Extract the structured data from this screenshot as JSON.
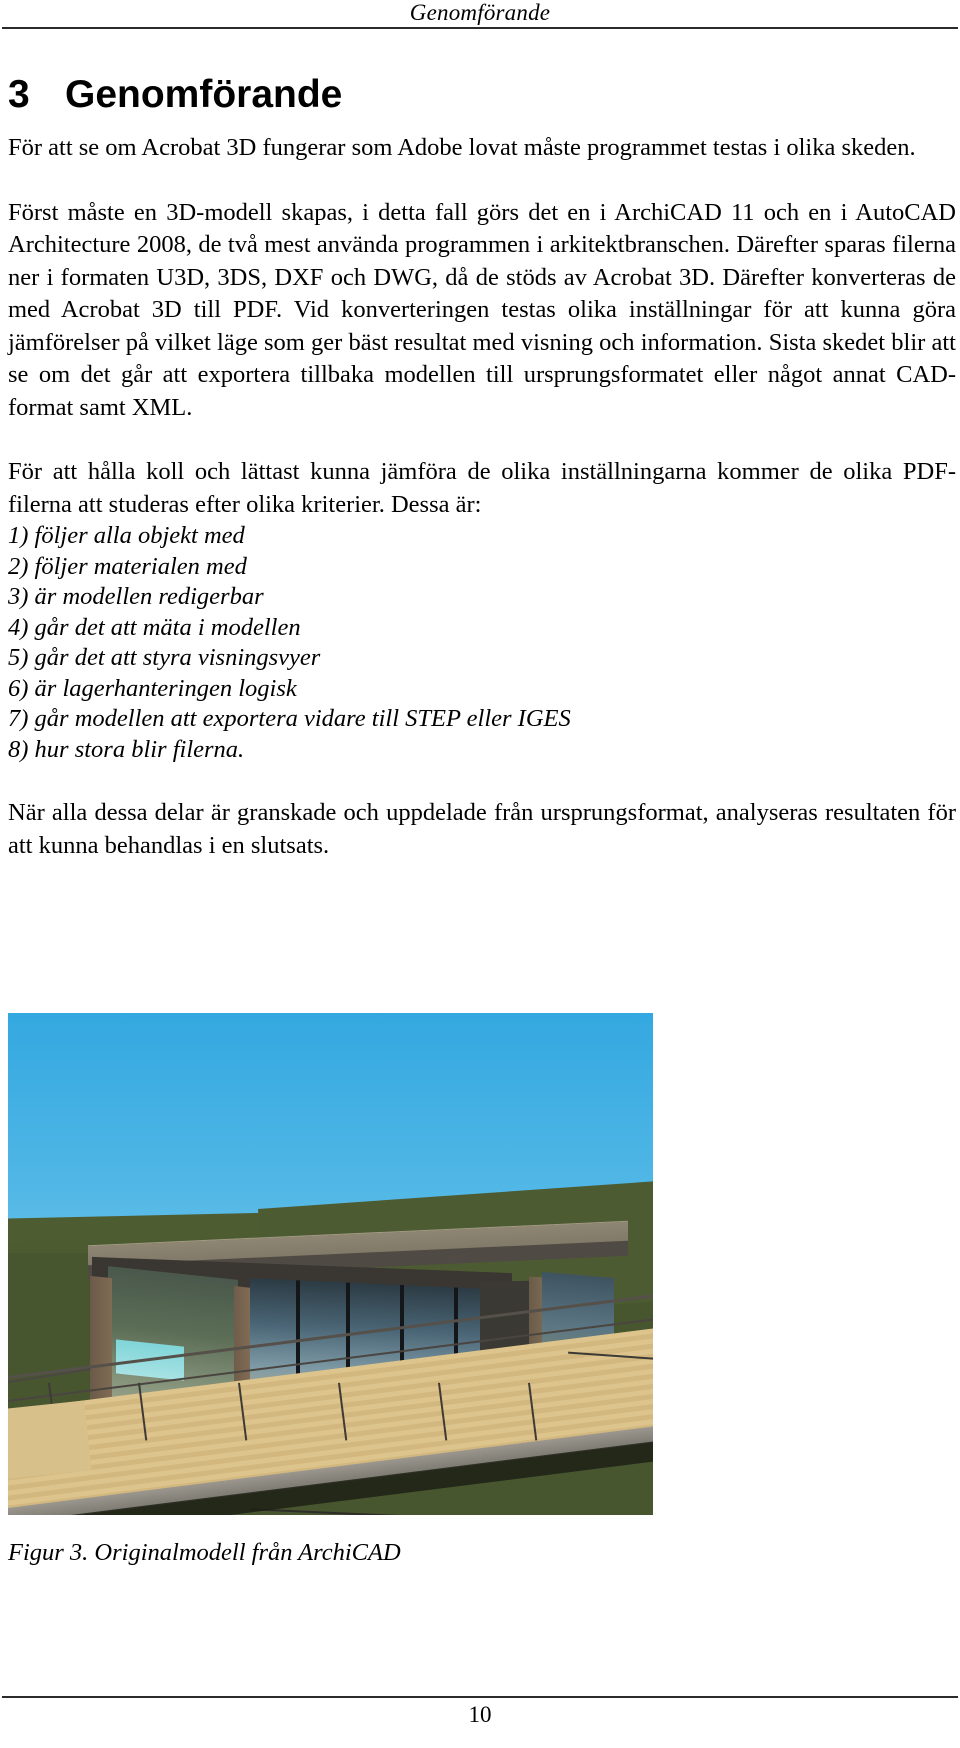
{
  "header": {
    "running_title": "Genomförande"
  },
  "heading": {
    "number": "3",
    "title": "Genomförande"
  },
  "body": {
    "paragraph_1": "För att se om Acrobat 3D fungerar som Adobe lovat måste programmet testas i olika skeden.",
    "paragraph_2": "Först måste en 3D-modell skapas, i detta fall görs det en i ArchiCAD 11 och en i AutoCAD Architecture 2008, de två mest använda programmen i arkitektbranschen. Därefter sparas filerna ner i formaten U3D, 3DS, DXF och DWG, då de stöds av Acrobat 3D. Därefter konverteras de med Acrobat 3D till PDF. Vid konverteringen testas olika inställningar för att kunna göra jämförelser på vilket läge som ger bäst resultat med visning och information. Sista skedet blir att se om det går att exportera tillbaka modellen till ursprungsformatet eller något annat CAD-format samt XML.",
    "paragraph_3": "För att hålla koll och lättast kunna jämföra de olika inställningarna kommer de olika PDF-filerna att studeras efter olika kriterier. Dessa är:",
    "criteria": [
      "1) följer alla objekt med",
      "2) följer materialen med",
      "3) är modellen redigerbar",
      "4) går det att mäta i modellen",
      "5) går det att styra visningsvyer",
      "6) är lagerhanteringen logisk",
      "7) går modellen att exportera vidare till STEP eller IGES",
      "8) hur stora blir filerna."
    ],
    "paragraph_4": "När alla dessa delar är granskade och uppdelade från ursprungsformat, analyseras resultaten för att kunna behandlas i en slutsats."
  },
  "figure": {
    "caption": "Figur 3. Originalmodell från ArchiCAD",
    "alt": "3D-renderad originalmodell av ett modernt enplanshus med platt tak, stor glasfasad och trädäck på en gräsbevuxen sluttning.",
    "colors": {
      "sky_top": "#33a8e0",
      "sky_bottom": "#8dd2ee",
      "grass": "#485630",
      "roof": "#8e8673",
      "wall_dark": "#3a3632",
      "deck_wood": "#ddc48c",
      "glass": "#5b7684",
      "brick_column": "#7c6b55"
    }
  },
  "footer": {
    "page_number": "10"
  }
}
